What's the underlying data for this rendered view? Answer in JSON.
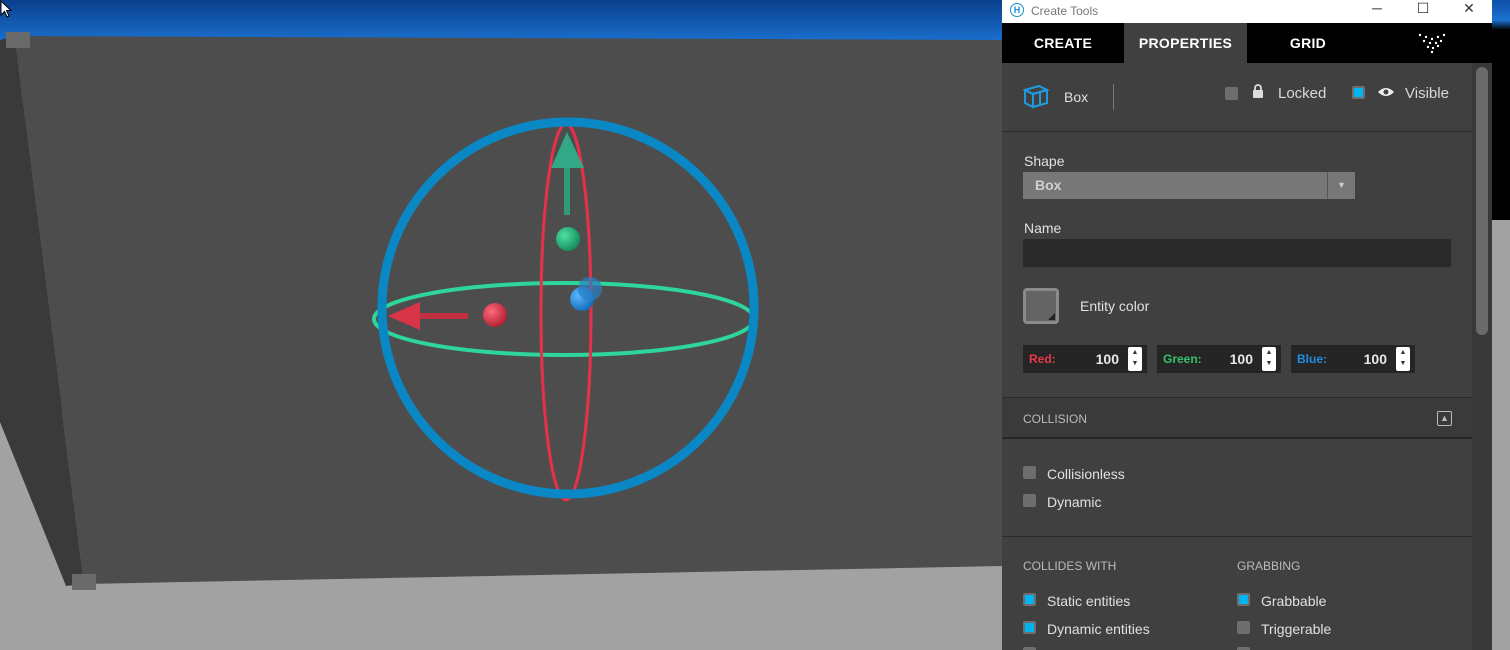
{
  "window": {
    "title": "Create Tools",
    "controls": {
      "minimize": "─",
      "maximize": "☐",
      "close": "✕"
    }
  },
  "tabs": [
    {
      "label": "CREATE"
    },
    {
      "label": "PROPERTIES",
      "active": true
    },
    {
      "label": "GRID"
    }
  ],
  "entity": {
    "type_label": "Box",
    "locked_label": "Locked",
    "locked": false,
    "visible_label": "Visible",
    "visible": true
  },
  "shape": {
    "label": "Shape",
    "value": "Box"
  },
  "name": {
    "label": "Name",
    "value": ""
  },
  "color": {
    "label": "Entity color",
    "channels": [
      {
        "label": "Red:",
        "value": "100",
        "color": "#e63a4b"
      },
      {
        "label": "Green:",
        "value": "100",
        "color": "#35c26b"
      },
      {
        "label": "Blue:",
        "value": "100",
        "color": "#1e8fe0"
      }
    ]
  },
  "collision": {
    "section_label": "COLLISION",
    "options": [
      {
        "label": "Collisionless",
        "checked": false
      },
      {
        "label": "Dynamic",
        "checked": false
      }
    ]
  },
  "collides_with": {
    "label": "COLLIDES WITH",
    "options": [
      {
        "label": "Static entities",
        "checked": true
      },
      {
        "label": "Dynamic entities",
        "checked": true
      }
    ]
  },
  "grabbing": {
    "label": "GRABBING",
    "options": [
      {
        "label": "Grabbable",
        "checked": true
      },
      {
        "label": "Triggerable",
        "checked": false
      }
    ]
  },
  "colors": {
    "accent": "#00b4ef",
    "panel": "#404040",
    "tab_bar": "#000000"
  }
}
